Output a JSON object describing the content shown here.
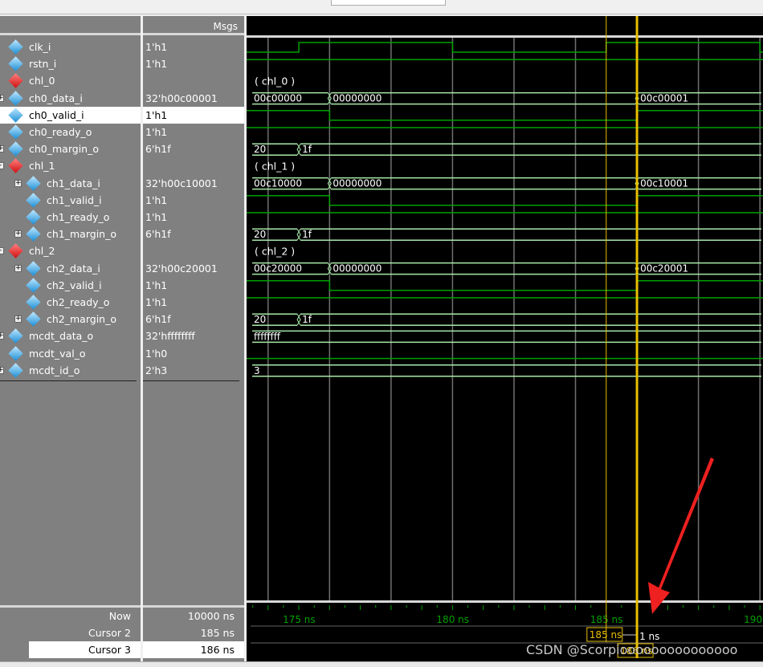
{
  "header": {
    "values_label": "Msgs"
  },
  "signals": [
    {
      "name": "clk_i",
      "value": "1'h1",
      "kind": "sig",
      "indent": 0,
      "expand": "",
      "wave": {
        "type": "bit",
        "init": 0,
        "edges": [
          175,
          180,
          185,
          190
        ]
      }
    },
    {
      "name": "rstn_i",
      "value": "1'h1",
      "kind": "sig",
      "indent": 0,
      "expand": "",
      "wave": {
        "type": "bit",
        "init": 1,
        "edges": []
      }
    },
    {
      "name": "chl_0",
      "value": "",
      "kind": "grp",
      "indent": 0,
      "expand": "",
      "wave": {
        "type": "label",
        "text": "( chl_0 )"
      }
    },
    {
      "name": "ch0_data_i",
      "value": "32'h00c00001",
      "kind": "sig",
      "indent": 0,
      "expand": "+",
      "wave": {
        "type": "bus",
        "segs": [
          [
            "00c00000",
            173
          ],
          [
            "00000000",
            176
          ],
          [
            "00c00001",
            186
          ]
        ]
      }
    },
    {
      "name": "ch0_valid_i",
      "value": "1'h1",
      "kind": "sig",
      "indent": 0,
      "expand": "",
      "selected": true,
      "wave": {
        "type": "bit",
        "init": 1,
        "edges": [
          176,
          186
        ]
      }
    },
    {
      "name": "ch0_ready_o",
      "value": "1'h1",
      "kind": "sig",
      "indent": 0,
      "expand": "",
      "wave": {
        "type": "bit",
        "init": 1,
        "edges": []
      }
    },
    {
      "name": "ch0_margin_o",
      "value": "6'h1f",
      "kind": "sig",
      "indent": 0,
      "expand": "+",
      "wave": {
        "type": "bus",
        "segs": [
          [
            "20",
            173
          ],
          [
            "1f",
            175
          ]
        ]
      }
    },
    {
      "name": "chl_1",
      "value": "",
      "kind": "grp",
      "indent": 0,
      "expand": "-",
      "wave": {
        "type": "label",
        "text": "( chl_1 )"
      }
    },
    {
      "name": "ch1_data_i",
      "value": "32'h00c10001",
      "kind": "sig",
      "indent": 1,
      "expand": "+",
      "wave": {
        "type": "bus",
        "segs": [
          [
            "00c10000",
            173
          ],
          [
            "00000000",
            176
          ],
          [
            "00c10001",
            186
          ]
        ]
      }
    },
    {
      "name": "ch1_valid_i",
      "value": "1'h1",
      "kind": "sig",
      "indent": 1,
      "expand": "",
      "wave": {
        "type": "bit",
        "init": 1,
        "edges": [
          176,
          186
        ]
      }
    },
    {
      "name": "ch1_ready_o",
      "value": "1'h1",
      "kind": "sig",
      "indent": 1,
      "expand": "",
      "wave": {
        "type": "bit",
        "init": 1,
        "edges": []
      }
    },
    {
      "name": "ch1_margin_o",
      "value": "6'h1f",
      "kind": "sig",
      "indent": 1,
      "expand": "+",
      "wave": {
        "type": "bus",
        "segs": [
          [
            "20",
            173
          ],
          [
            "1f",
            175
          ]
        ]
      }
    },
    {
      "name": "chl_2",
      "value": "",
      "kind": "grp",
      "indent": 0,
      "expand": "-",
      "wave": {
        "type": "label",
        "text": "( chl_2 )"
      }
    },
    {
      "name": "ch2_data_i",
      "value": "32'h00c20001",
      "kind": "sig",
      "indent": 1,
      "expand": "+",
      "wave": {
        "type": "bus",
        "segs": [
          [
            "00c20000",
            173
          ],
          [
            "00000000",
            176
          ],
          [
            "00c20001",
            186
          ]
        ]
      }
    },
    {
      "name": "ch2_valid_i",
      "value": "1'h1",
      "kind": "sig",
      "indent": 1,
      "expand": "",
      "wave": {
        "type": "bit",
        "init": 1,
        "edges": [
          176,
          186
        ]
      }
    },
    {
      "name": "ch2_ready_o",
      "value": "1'h1",
      "kind": "sig",
      "indent": 1,
      "expand": "",
      "wave": {
        "type": "bit",
        "init": 1,
        "edges": []
      }
    },
    {
      "name": "ch2_margin_o",
      "value": "6'h1f",
      "kind": "sig",
      "indent": 1,
      "expand": "+",
      "wave": {
        "type": "bus",
        "segs": [
          [
            "20",
            173
          ],
          [
            "1f",
            175
          ]
        ]
      }
    },
    {
      "name": "mcdt_data_o",
      "value": "32'hffffffff",
      "kind": "sig",
      "indent": 0,
      "expand": "+",
      "wave": {
        "type": "bus",
        "segs": [
          [
            "ffffffff",
            173
          ]
        ]
      }
    },
    {
      "name": "mcdt_val_o",
      "value": "1'h0",
      "kind": "sig",
      "indent": 0,
      "expand": "",
      "wave": {
        "type": "bit",
        "init": 0,
        "edges": []
      }
    },
    {
      "name": "mcdt_id_o",
      "value": "2'h3",
      "kind": "sig",
      "indent": 0,
      "expand": "+",
      "wave": {
        "type": "bus",
        "segs": [
          [
            "3",
            173
          ]
        ]
      }
    }
  ],
  "timeline": {
    "ticks": [
      {
        "t": 175,
        "label": "175 ns"
      },
      {
        "t": 180,
        "label": "180 ns"
      },
      {
        "t": 185,
        "label": "185 ns"
      },
      {
        "t": 190,
        "label": "190"
      }
    ],
    "grid_step_ns": 2,
    "range_ns": [
      173.3,
      190.1
    ]
  },
  "now": {
    "label": "Now",
    "value": "10000 ns"
  },
  "cursors": [
    {
      "label": "Cursor 2",
      "value": "185 ns",
      "t": 185,
      "tag": "185 ns",
      "delta": "1 ns"
    },
    {
      "label": "Cursor 3",
      "value": "186 ns",
      "t": 186,
      "tag": "186 ns",
      "selected": true
    }
  ],
  "colors": {
    "wave": "#00a000",
    "bus": "#a8e8a8",
    "cursor": "#e8c000",
    "grid": "#707070",
    "tick_text": "#00a000"
  },
  "watermark": "CSDN @Scorpiooooooooooooooo"
}
